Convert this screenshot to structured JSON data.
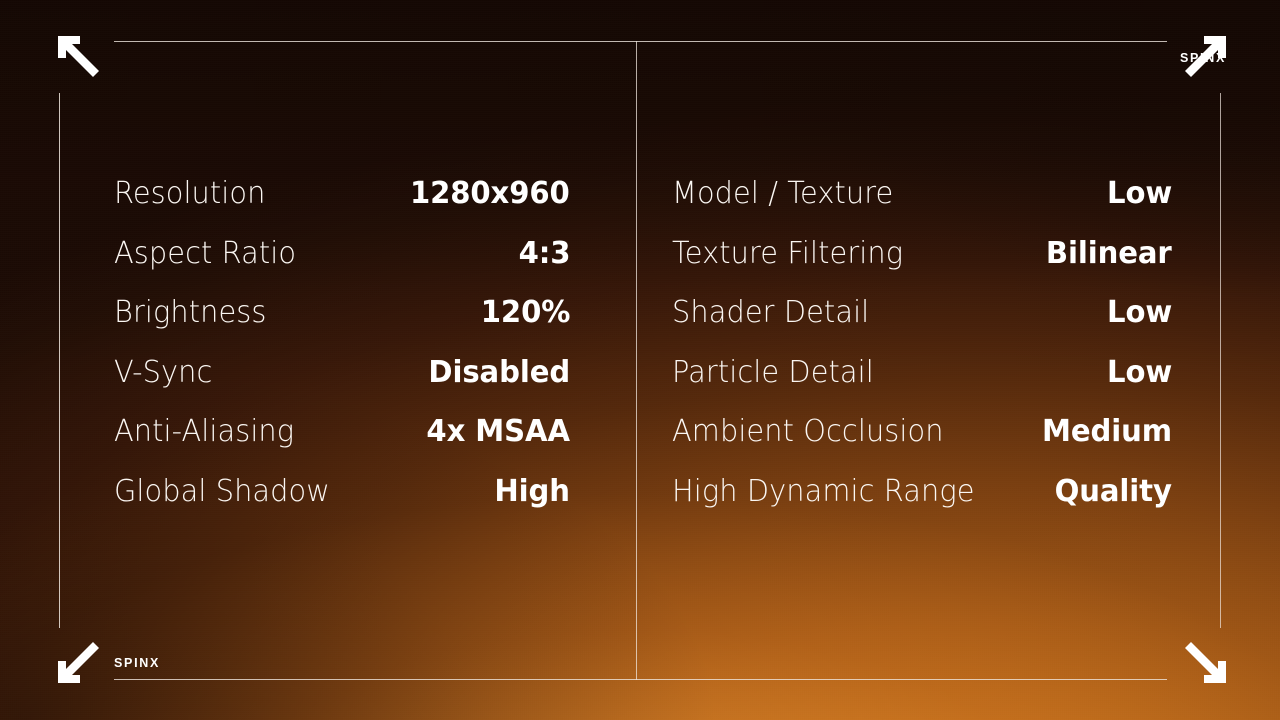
{
  "brand": {
    "top_right": "SPINX",
    "bottom_left": "SPINX"
  },
  "icons": {
    "top_left": "arrow-up-left-icon",
    "top_right": "arrow-up-right-icon",
    "bottom_left": "arrow-down-left-icon",
    "bottom_right": "arrow-down-right-icon"
  },
  "colors": {
    "background_dark": "#1e0e07",
    "background_mid": "#7d4111",
    "background_bright": "#cf7a20",
    "text": "#ffffff",
    "rule": "#efe6de"
  },
  "settings": {
    "left_column": [
      {
        "label": "Resolution",
        "value": "1280x960"
      },
      {
        "label": "Aspect Ratio",
        "value": "4:3"
      },
      {
        "label": "Brightness",
        "value": "120%"
      },
      {
        "label": "V-Sync",
        "value": "Disabled"
      },
      {
        "label": "Anti-Aliasing",
        "value": "4x MSAA"
      },
      {
        "label": "Global Shadow",
        "value": "High"
      }
    ],
    "right_column": [
      {
        "label": "Model / Texture",
        "value": "Low"
      },
      {
        "label": "Texture Filtering",
        "value": "Bilinear"
      },
      {
        "label": "Shader Detail",
        "value": "Low"
      },
      {
        "label": "Particle Detail",
        "value": "Low"
      },
      {
        "label": "Ambient Occlusion",
        "value": "Medium"
      },
      {
        "label": "High Dynamic Range",
        "value": "Quality"
      }
    ]
  }
}
